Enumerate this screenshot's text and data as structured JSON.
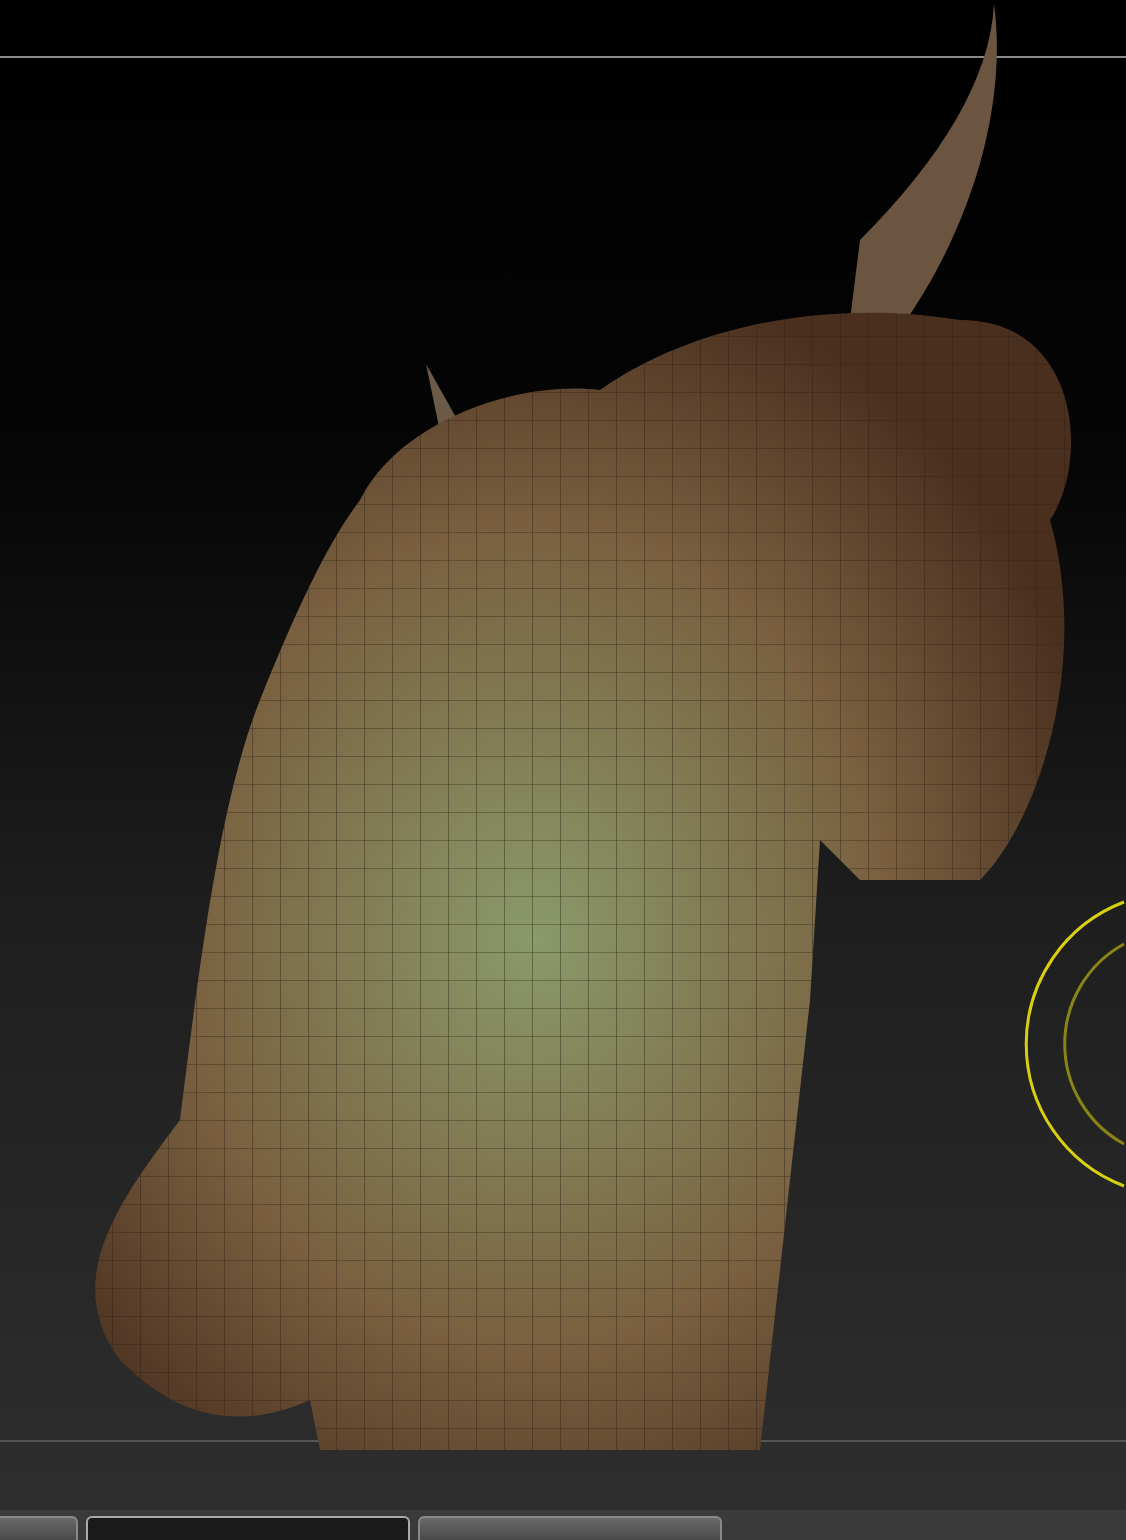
{
  "taskbar": {
    "items": [
      {
        "selected": false
      },
      {
        "selected": true
      },
      {
        "selected": false
      }
    ]
  }
}
